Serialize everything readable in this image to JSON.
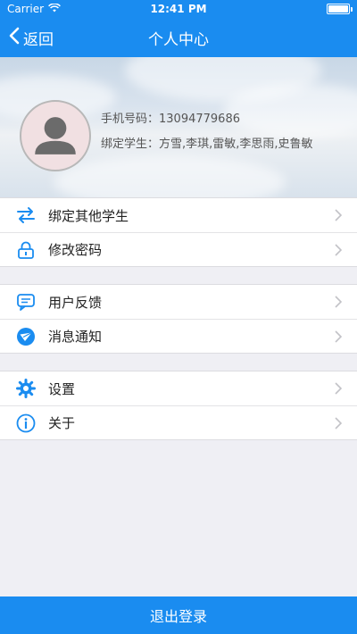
{
  "status_bar": {
    "carrier": "Carrier",
    "time": "12:41 PM",
    "battery_level": 1.0
  },
  "nav": {
    "back_label": "返回",
    "title": "个人中心"
  },
  "profile": {
    "phone_label": "手机号码：",
    "phone": "13094779686",
    "students_label": "绑定学生：",
    "students": "方雪,李琪,雷敏,李思雨,史鲁敏"
  },
  "menu_groups": [
    [
      {
        "label": "绑定其他学生",
        "icon": "swap-arrows-icon"
      },
      {
        "label": "修改密码",
        "icon": "lock-icon"
      }
    ],
    [
      {
        "label": "用户反馈",
        "icon": "chat-bubble-icon"
      },
      {
        "label": "消息通知",
        "icon": "envelope-icon"
      }
    ],
    [
      {
        "label": "设置",
        "icon": "gear-icon"
      },
      {
        "label": "关于",
        "icon": "info-icon"
      }
    ]
  ],
  "logout_label": "退出登录",
  "colors": {
    "accent": "#1a8cf0",
    "background": "#efeff4"
  }
}
